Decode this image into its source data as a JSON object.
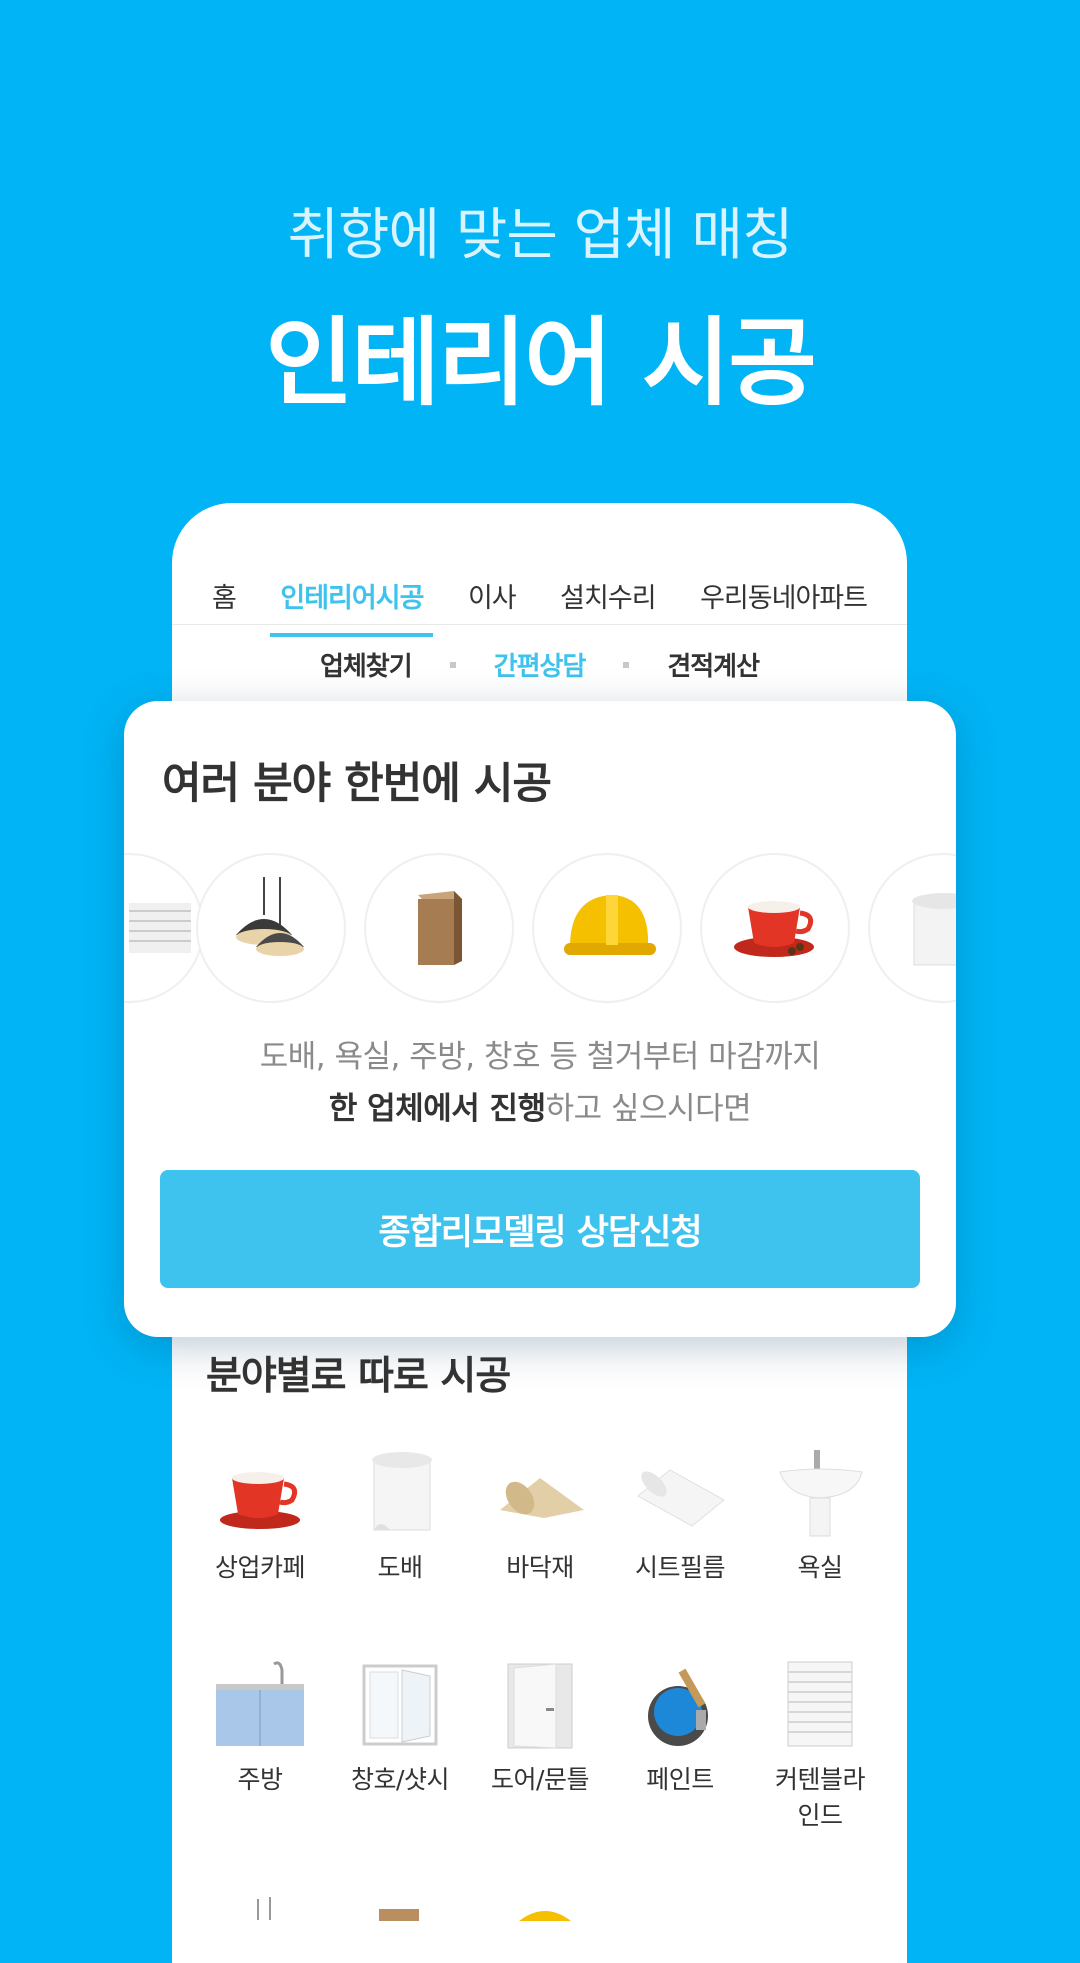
{
  "hero": {
    "subtitle": "취향에 맞는 업체 매칭",
    "title": "인테리어 시공"
  },
  "tabs": [
    "홈",
    "인테리어시공",
    "이사",
    "설치수리",
    "우리동네아파트"
  ],
  "subtabs": [
    "업체찾기",
    "간편상담",
    "견적계산"
  ],
  "card": {
    "title": "여러 분야 한번에 시공",
    "desc_line1": "도배, 욕실, 주방, 창호 등 철거부터 마감까지",
    "desc_bold": "한 업체에서 진행",
    "desc_rest": "하고 싶으시다면",
    "cta": "종합리모델링 상담신청",
    "icons": [
      "blinds-icon",
      "pendant-lamp-icon",
      "wood-block-icon",
      "hard-hat-icon",
      "coffee-cup-icon",
      "wallpaper-roll-icon"
    ]
  },
  "section": {
    "title": "분야별로 따로 시공",
    "items": [
      {
        "label": "상업카페",
        "icon": "coffee-cup-icon"
      },
      {
        "label": "도배",
        "icon": "wallpaper-roll-icon"
      },
      {
        "label": "바닥재",
        "icon": "floor-roll-icon"
      },
      {
        "label": "시트필름",
        "icon": "sheet-film-icon"
      },
      {
        "label": "욕실",
        "icon": "sink-icon"
      },
      {
        "label": "주방",
        "icon": "kitchen-icon"
      },
      {
        "label": "창호/샷시",
        "icon": "window-icon"
      },
      {
        "label": "도어/문틀",
        "icon": "door-icon"
      },
      {
        "label": "페인트",
        "icon": "paint-can-icon"
      },
      {
        "label": "커텐블라\n인드",
        "icon": "blinds-icon"
      }
    ]
  },
  "colors": {
    "background": "#00b4f5",
    "accent": "#3ec3ee",
    "card": "#ffffff"
  }
}
